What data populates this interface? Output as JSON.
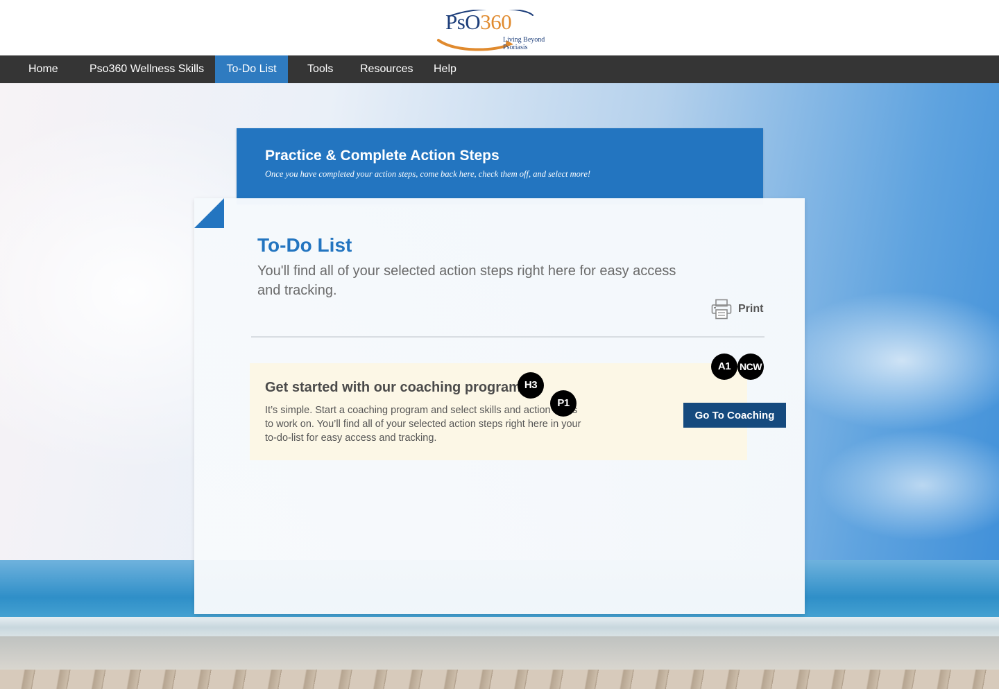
{
  "brand": {
    "logo_name": "PsO",
    "logo_number": "360",
    "tagline_line1": "Living Beyond",
    "tagline_line2": "Psoriasis",
    "accent_color": "#2375c0",
    "orange_color": "#e08a2e"
  },
  "nav": {
    "items": [
      {
        "label": "Home",
        "active": false
      },
      {
        "label": "Pso360 Wellness Skills",
        "active": false
      },
      {
        "label": "To-Do List",
        "active": true
      },
      {
        "label": "Tools",
        "active": false
      },
      {
        "label": "Resources",
        "active": false
      },
      {
        "label": "Help",
        "active": false
      }
    ]
  },
  "banner": {
    "title": "Practice & Complete Action Steps",
    "subtitle": "Once you have completed your action steps, come back here, check them off, and select more!"
  },
  "card": {
    "title": "To-Do List",
    "subtitle": "You'll find all of your selected action steps right here for easy access and tracking.",
    "print_label": "Print",
    "print_icon": "printer-icon"
  },
  "callout": {
    "title": "Get started with our coaching program",
    "body": "It’s simple.  Start a coaching program and select skills and action steps to work on.  You’ll find all of your selected action steps right here in your to-do-list for easy access and tracking.",
    "button_label": "Go To Coaching",
    "button_color": "#154a7e",
    "background_color": "#fcf7e6"
  },
  "markers": [
    "H3",
    "P1",
    "A1",
    "NCW"
  ]
}
